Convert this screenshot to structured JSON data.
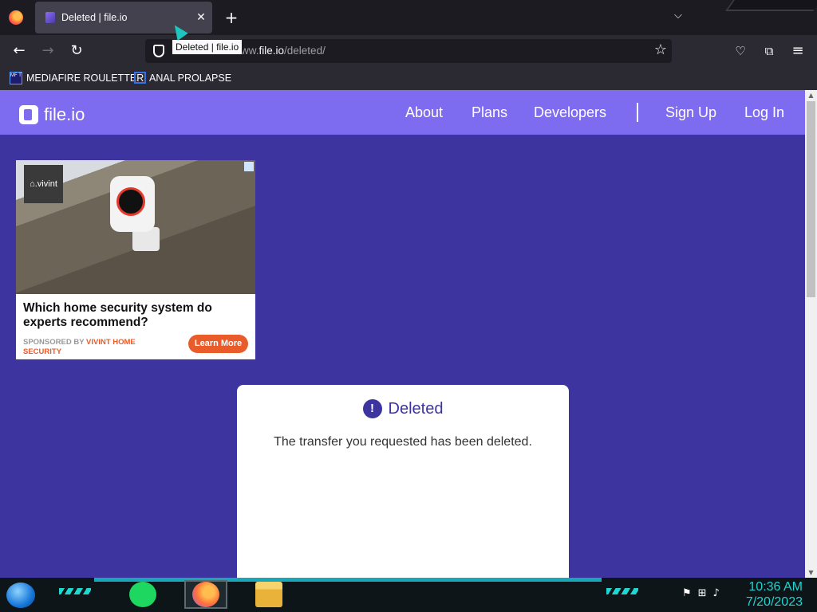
{
  "browser": {
    "tab_title": "Deleted | file.io",
    "tooltip": "Deleted | file.io",
    "url_prefix": "ww.",
    "url_host": "file.io",
    "url_path": "/deleted/",
    "bookmarks": [
      "MEDIAFIRE ROULETTER",
      "ANAL PROLAPSE"
    ],
    "bookmark_icon_text": "MF T"
  },
  "site": {
    "logo_text": "file.io",
    "nav": [
      "About",
      "Plans",
      "Developers",
      "Sign Up",
      "Log In"
    ],
    "header_color": "#7d6cf0",
    "bg_color": "#3d34a0"
  },
  "ad": {
    "brand_badge": "⌂.vivint",
    "headline": "Which home security system do experts recommend?",
    "sponsor_prefix": "SPONSORED BY ",
    "sponsor_brand": "VIVINT HOME SECURITY",
    "cta": "Learn More"
  },
  "card": {
    "icon": "!",
    "title": "Deleted",
    "message": "The transfer you requested has been deleted."
  },
  "taskbar": {
    "time": "10:36 AM",
    "date": "7/20/2023"
  }
}
